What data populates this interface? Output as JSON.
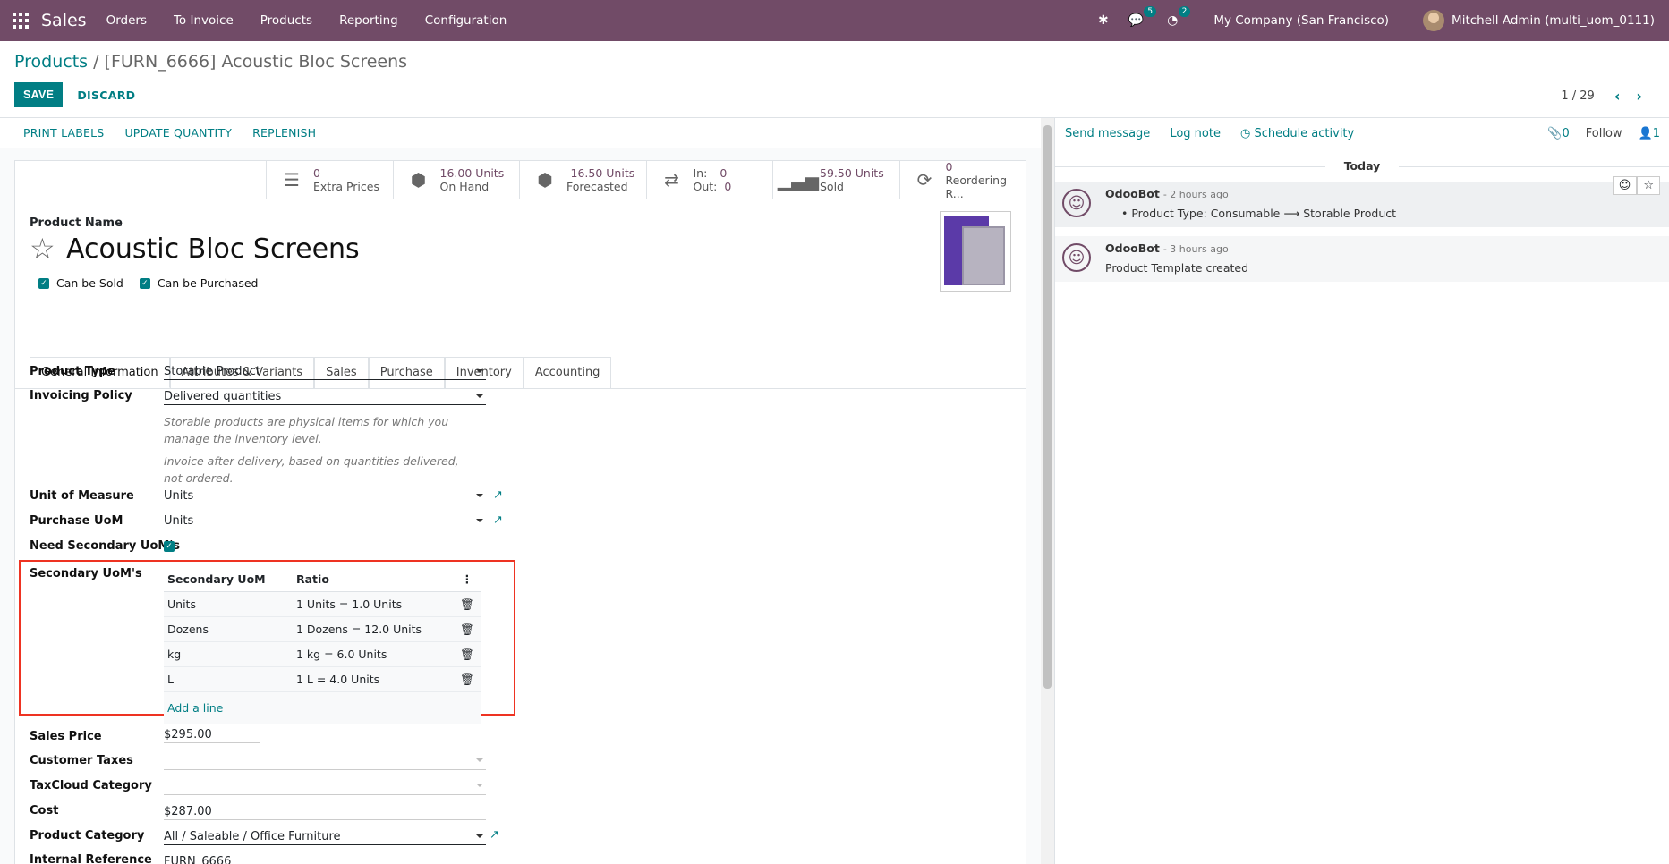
{
  "topbar": {
    "app": "Sales",
    "menu": [
      "Orders",
      "To Invoice",
      "Products",
      "Reporting",
      "Configuration"
    ],
    "msg_count": "5",
    "activity_count": "2",
    "company": "My Company (San Francisco)",
    "user": "Mitchell Admin (multi_uom_0111)"
  },
  "breadcrumb": {
    "parent": "Products",
    "current": "[FURN_6666] Acoustic Bloc Screens"
  },
  "buttons": {
    "save": "SAVE",
    "discard": "DISCARD"
  },
  "pager": {
    "value": "1 / 29"
  },
  "header": {
    "print": "PRINT LABELS",
    "update": "UPDATE QUANTITY",
    "replenish": "REPLENISH"
  },
  "smart": {
    "extra": {
      "val": "0",
      "lbl": "Extra Prices"
    },
    "onhand": {
      "val": "16.00 Units",
      "lbl": "On Hand"
    },
    "forecast": {
      "val": "-16.50 Units",
      "lbl": "Forecasted"
    },
    "inout": {
      "in_lbl": "In:",
      "in": "0",
      "out_lbl": "Out:",
      "out": "0"
    },
    "sold": {
      "val": "59.50 Units",
      "lbl": "Sold"
    },
    "reorder": {
      "val": "0",
      "lbl": "Reordering R..."
    }
  },
  "product": {
    "name_label": "Product Name",
    "name": "Acoustic Bloc Screens",
    "can_sold": "Can be Sold",
    "can_purchased": "Can be Purchased"
  },
  "tabs": [
    "General Information",
    "Attributes & Variants",
    "Sales",
    "Purchase",
    "Inventory",
    "Accounting"
  ],
  "fields": {
    "type_l": "Product Type",
    "type_v": "Storable Product",
    "inv_l": "Invoicing Policy",
    "inv_v": "Delivered quantities",
    "help1": "Storable products are physical items for which you manage the inventory level.",
    "help2": "Invoice after delivery, based on quantities delivered, not ordered.",
    "uom_l": "Unit of Measure",
    "uom_v": "Units",
    "puom_l": "Purchase UoM",
    "puom_v": "Units",
    "need_l": "Need Secondary UoM's",
    "sec_l": "Secondary UoM's",
    "price_l": "Sales Price",
    "price_v": "$295.00",
    "tax_l": "Customer Taxes",
    "taxcloud_l": "TaxCloud Category",
    "cost_l": "Cost",
    "cost_v": "$287.00",
    "categ_l": "Product Category",
    "categ_v": "All / Saleable / Office Furniture",
    "ref_l": "Internal Reference",
    "ref_v": "FURN_6666"
  },
  "secondary": {
    "h1": "Secondary UoM",
    "h2": "Ratio",
    "rows": [
      [
        "Units",
        "1 Units = 1.0 Units"
      ],
      [
        "Dozens",
        "1 Dozens = 12.0 Units"
      ],
      [
        "kg",
        "1 kg = 6.0 Units"
      ],
      [
        "L",
        "1 L = 4.0 Units"
      ]
    ],
    "add": "Add a line"
  },
  "chatter": {
    "send": "Send message",
    "log": "Log note",
    "schedule": "Schedule activity",
    "attach": "0",
    "follow": "Follow",
    "followers": "1",
    "today": "Today",
    "m1": {
      "author": "OdooBot",
      "time": "- 2 hours ago",
      "body": "Product Type: Consumable ⟶ Storable Product"
    },
    "m2": {
      "author": "OdooBot",
      "time": "- 3 hours ago",
      "body": "Product Template created"
    }
  }
}
